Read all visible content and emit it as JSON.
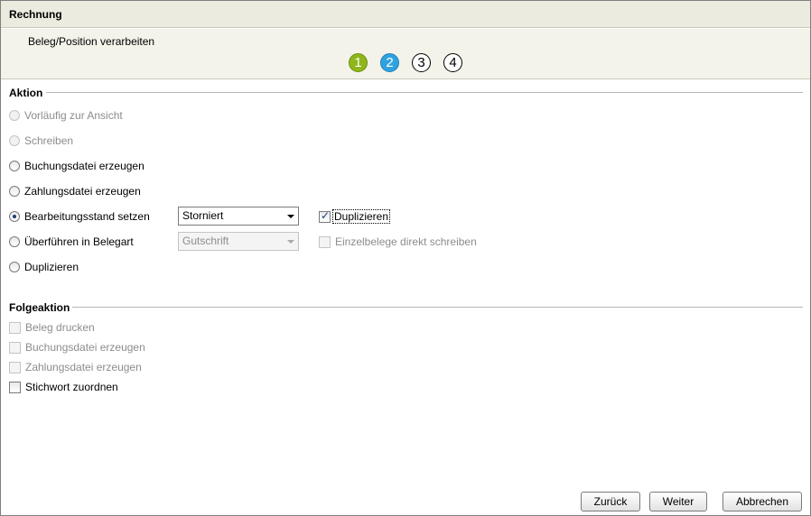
{
  "window": {
    "title": "Rechnung"
  },
  "subheader": {
    "text": "Beleg/Position verarbeiten"
  },
  "steps": [
    "1",
    "2",
    "3",
    "4"
  ],
  "aktion": {
    "heading": "Aktion",
    "options": {
      "vorlaeufig": "Vorläufig zur Ansicht",
      "schreiben": "Schreiben",
      "buchungsdatei": "Buchungsdatei erzeugen",
      "zahlungsdatei": "Zahlungsdatei erzeugen",
      "bearbeitungsstand": "Bearbeitungsstand setzen",
      "ueberfuehren": "Überführen in Belegart",
      "duplizieren": "Duplizieren"
    },
    "bearbeitungsstand_select": "Storniert",
    "belegart_select": "Gutschrift",
    "duplizieren_check": "Duplizieren",
    "einzelbelege_check": "Einzelbelege direkt schreiben"
  },
  "folgeaktion": {
    "heading": "Folgeaktion",
    "beleg_drucken": "Beleg drucken",
    "buchungsdatei": "Buchungsdatei erzeugen",
    "zahlungsdatei": "Zahlungsdatei erzeugen",
    "stichwort": "Stichwort zuordnen"
  },
  "buttons": {
    "back": "Zurück",
    "next": "Weiter",
    "cancel": "Abbrechen"
  }
}
